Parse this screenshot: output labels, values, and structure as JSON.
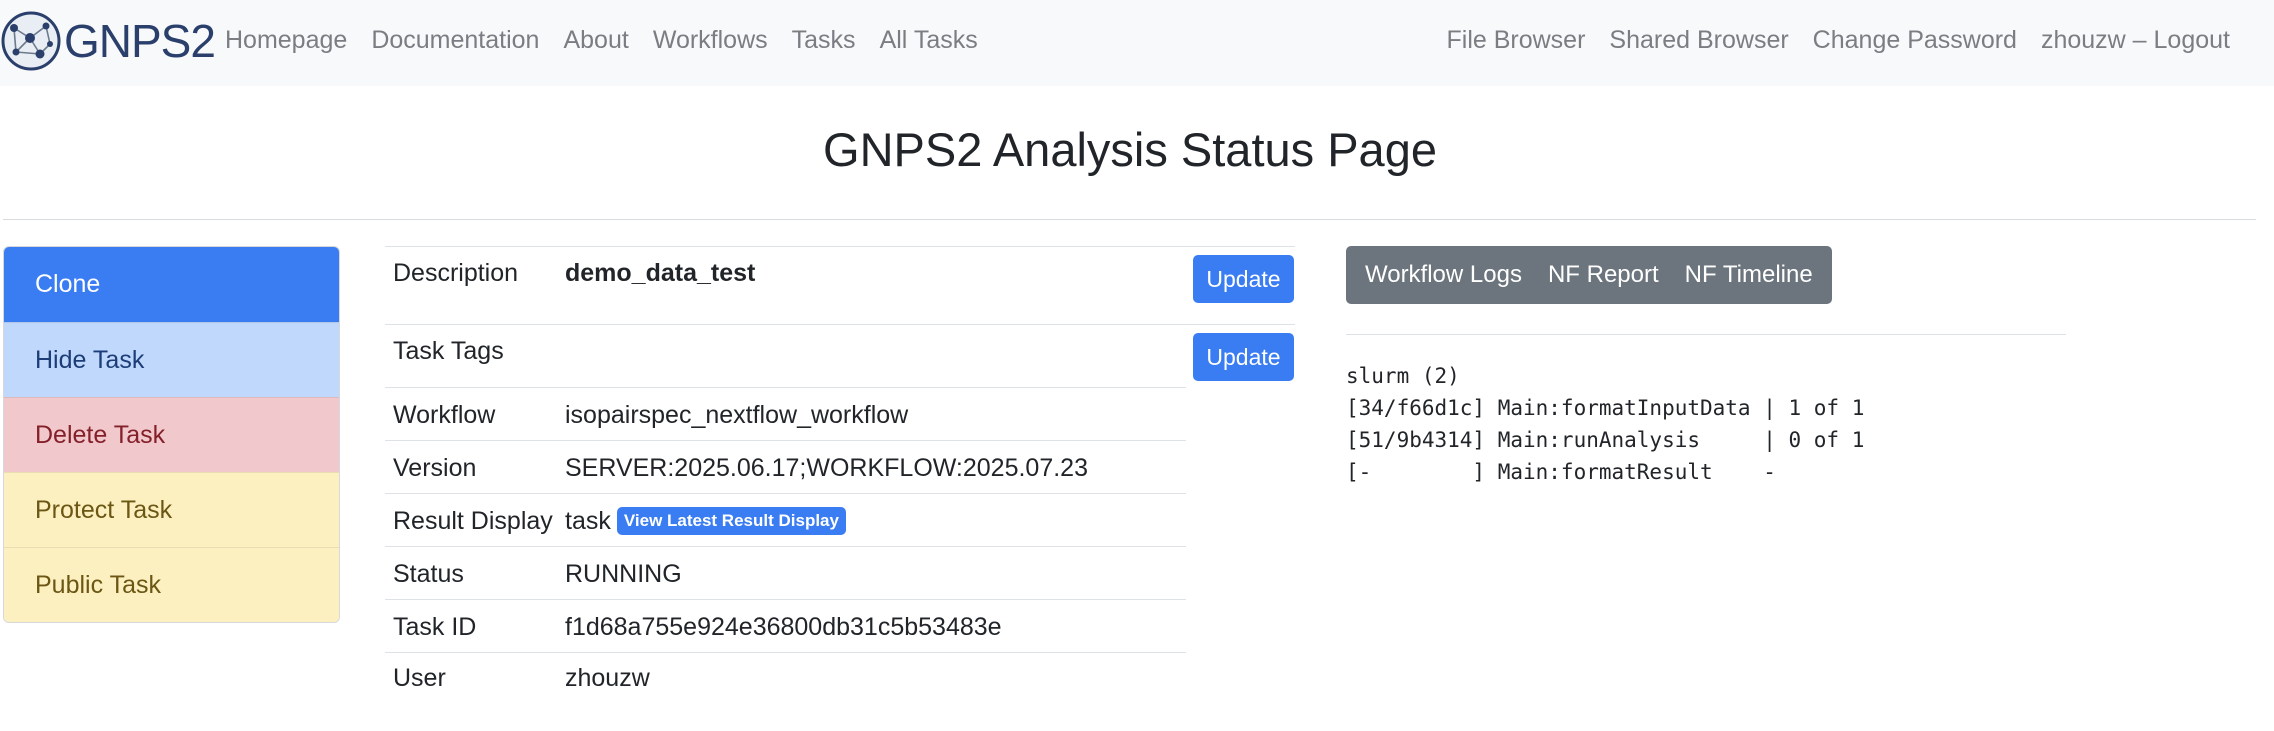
{
  "brand": {
    "logo_text": "GNPS2"
  },
  "nav": {
    "left": [
      "Homepage",
      "Documentation",
      "About",
      "Workflows",
      "Tasks",
      "All Tasks"
    ],
    "right": [
      "File Browser",
      "Shared Browser",
      "Change Password",
      "zhouzw – Logout"
    ]
  },
  "page_title": "GNPS2 Analysis Status Page",
  "actions": [
    "Clone",
    "Hide Task",
    "Delete Task",
    "Protect Task",
    "Public Task"
  ],
  "details": {
    "description": {
      "label": "Description",
      "value": "demo_data_test",
      "button": "Update"
    },
    "task_tags": {
      "label": "Task Tags",
      "value": "",
      "button": "Update"
    },
    "workflow": {
      "label": "Workflow",
      "value": "isopairspec_nextflow_workflow"
    },
    "version": {
      "label": "Version",
      "value": "SERVER:2025.06.17;WORKFLOW:2025.07.23"
    },
    "result_display": {
      "label": "Result Display",
      "value": "task",
      "link": "View Latest Result Display"
    },
    "status": {
      "label": "Status",
      "value": "RUNNING"
    },
    "task_id": {
      "label": "Task ID",
      "value": "f1d68a755e924e36800db31c5b53483e"
    },
    "user": {
      "label": "User",
      "value": "zhouzw"
    }
  },
  "log_tabs": [
    "Workflow Logs",
    "NF Report",
    "NF Timeline"
  ],
  "log_lines": [
    "slurm (2)",
    "[34/f66d1c] Main:formatInputData | 1 of 1",
    "[51/9b4314] Main:runAnalysis     | 0 of 1",
    "[-        ] Main:formatResult    -"
  ],
  "colors": {
    "primary": "#3a7cf2",
    "secondary": "#6c757d",
    "danger_light": "#f1c9cd",
    "warning_light": "#fdf0c0",
    "primary_light": "#c0d8fb"
  },
  "icons": {
    "logo": "globe-network-logo"
  }
}
